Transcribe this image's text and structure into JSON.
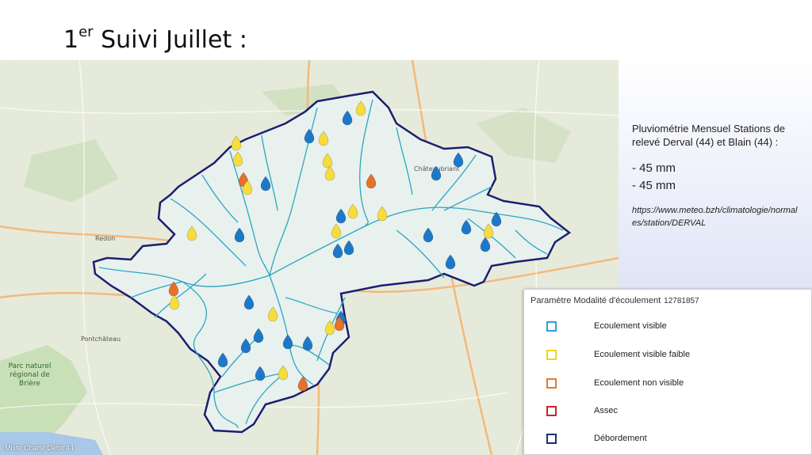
{
  "slide": {
    "title_main": "1",
    "title_sup": "er",
    "title_rest": " Suivi Juillet :"
  },
  "map": {
    "places": {
      "redon": "Redon",
      "pontchateau": "Pontchâteau",
      "park": "Parc naturel régional de Brière",
      "chateaubriant": "Châteaubriant"
    },
    "attribution": "Mixte Charte Débit 44",
    "colors": {
      "basin_border": "#1b1f6e",
      "rivers": "#2aa6c2",
      "basin_fill": "#eaf1ee",
      "blue_marker": "#1e78c8",
      "yellow_marker": "#f7dc3c",
      "orange_marker": "#e5712b"
    }
  },
  "info": {
    "heading": "Pluviométrie Mensuel Stations de relevé Derval (44) et Blain (44) :",
    "value_1": "- 45 mm",
    "value_2": "- 45 mm",
    "source": "https://www.meteo.bzh/climatologie/normales/station/DERVAL"
  },
  "legend": {
    "title": "Paramètre Modalité d'écoulement",
    "code": "12781857",
    "items": [
      {
        "label": "Ecoulement visible",
        "color": "#2e9fd9"
      },
      {
        "label": "Ecoulement visible faible",
        "color": "#f2d31b"
      },
      {
        "label": "Ecoulement non visible",
        "color": "#e8782b"
      },
      {
        "label": "Assec",
        "color": "#c62828"
      },
      {
        "label": "Débordement",
        "color": "#1f2d7a"
      }
    ]
  }
}
